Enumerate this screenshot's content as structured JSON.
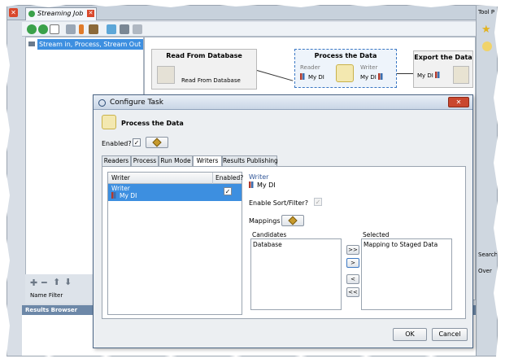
{
  "editor": {
    "tab_label": "Streaming Job",
    "tree_item": "Stream in, Process, Stream Out",
    "name_filter_label": "Name Filter",
    "results_browser_label": "Results Browser"
  },
  "canvas": {
    "steps": {
      "read": {
        "title": "Read From Database",
        "sub": "Read From Database"
      },
      "process": {
        "title": "Process the Data",
        "reader_label": "Reader",
        "reader_value": "My DI",
        "writer_label": "Writer",
        "writer_value": "My DI"
      },
      "export": {
        "title": "Export the Data",
        "input_value": "My DI"
      }
    }
  },
  "right_panel": {
    "tool_label": "Tool P",
    "search_label": "Search",
    "over_label": "Over"
  },
  "dialog": {
    "title": "Configure Task",
    "task_name": "Process the Data",
    "enabled_label": "Enabled?",
    "enabled_checked": true,
    "tabs": [
      {
        "label": "Readers"
      },
      {
        "label": "Process"
      },
      {
        "label": "Run Mode"
      },
      {
        "label": "Writers"
      },
      {
        "label": "Results Publishing"
      }
    ],
    "active_tab": "Writers",
    "writers_table": {
      "col_writer": "Writer",
      "col_enabled": "Enabled?",
      "row": {
        "writer_label": "Writer",
        "writer_value": "My DI",
        "enabled": true
      }
    },
    "detail": {
      "writer_label": "Writer",
      "writer_value": "My DI",
      "sort_filter_label": "Enable Sort/Filter?",
      "mappings_label": "Mappings",
      "candidates_label": "Candidates",
      "candidates": [
        "Database"
      ],
      "selected_label": "Selected",
      "selected": [
        "Mapping to Staged Data"
      ],
      "move_all_right": ">>",
      "move_right": ">",
      "move_left": "<",
      "move_all_left": "<<"
    },
    "ok_label": "OK",
    "cancel_label": "Cancel"
  },
  "colors": {
    "selection_blue": "#3d8fe0",
    "frame_bg": "#d8dee6",
    "close_red": "#c9472f"
  }
}
